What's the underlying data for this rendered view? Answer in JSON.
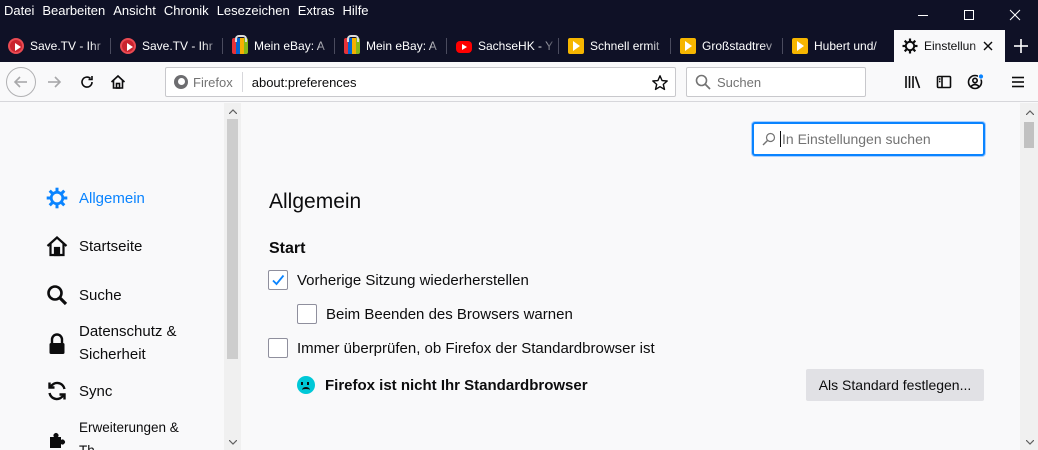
{
  "menubar": {
    "items": [
      {
        "label": "Datei"
      },
      {
        "label": "Bearbeiten"
      },
      {
        "label": "Ansicht"
      },
      {
        "label": "Chronik"
      },
      {
        "label": "Lesezeichen"
      },
      {
        "label": "Extras"
      },
      {
        "label": "Hilfe"
      }
    ]
  },
  "tabs": [
    {
      "label": "Save.TV - Ihr",
      "icon": "savetv-icon"
    },
    {
      "label": "Save.TV - Ihr",
      "icon": "savetv-icon"
    },
    {
      "label": "Mein eBay: A",
      "icon": "ebay-icon"
    },
    {
      "label": "Mein eBay: A",
      "icon": "ebay-icon"
    },
    {
      "label": "SachseHK - Y",
      "icon": "youtube-icon"
    },
    {
      "label": "Schnell ermit",
      "icon": "play-icon"
    },
    {
      "label": "Großstadtrev",
      "icon": "play-icon"
    },
    {
      "label": "Hubert und/",
      "icon": "play-icon"
    },
    {
      "label": "Einstellun",
      "icon": "gear-icon",
      "active": true
    }
  ],
  "navbar": {
    "identity_label": "Firefox",
    "url": "about:preferences",
    "search_placeholder": "Suchen"
  },
  "sidebar": {
    "categories": [
      {
        "label": "Allgemein",
        "icon": "gear-icon",
        "selected": true
      },
      {
        "label": "Startseite",
        "icon": "home-icon"
      },
      {
        "label": "Suche",
        "icon": "search-icon"
      },
      {
        "label": "Datenschutz & Sicherheit",
        "line1": "Datenschutz &",
        "line2": "Sicherheit",
        "icon": "lock-icon"
      },
      {
        "label": "Sync",
        "icon": "sync-icon"
      },
      {
        "label": "Erweiterungen & Themes",
        "line1": "Erweiterungen &",
        "line2": "Th",
        "icon": "puzzle-icon"
      }
    ]
  },
  "main": {
    "search_placeholder": "In Einstellungen suchen",
    "heading": "Allgemein",
    "section_start": "Start",
    "restore_session": {
      "label": "Vorherige Sitzung wiederherstellen",
      "checked": true
    },
    "warn_on_quit": {
      "label": "Beim Beenden des Browsers warnen",
      "checked": false
    },
    "check_default": {
      "label": "Immer überprüfen, ob Firefox der Standardbrowser ist",
      "checked": false
    },
    "not_default_text": "Firefox ist nicht Ihr Standardbrowser",
    "set_default_button": "Als Standard festlegen..."
  },
  "colors": {
    "titlebar": "#0f1126",
    "accent": "#0a84ff",
    "face": "#00c8d7"
  }
}
